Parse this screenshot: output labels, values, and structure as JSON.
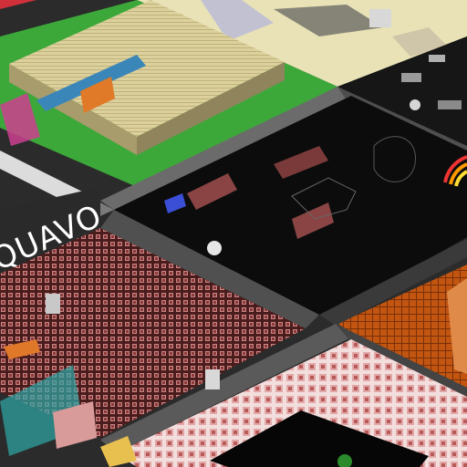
{
  "scene": {
    "view": "isometric",
    "background": "#2b2b2b"
  },
  "plots": [
    {
      "id": "green-building-plot",
      "ground": "#3da83a",
      "content": "warehouse-roof"
    },
    {
      "id": "cream-plot",
      "ground": "#e8e2b6",
      "content": "scattered-structures"
    },
    {
      "id": "dark-gadget-plot",
      "ground": "#161616",
      "content": "grey-machines"
    },
    {
      "id": "center-black-plot",
      "ground": "#0c0c0c",
      "content": "circuit-glyphs"
    },
    {
      "id": "red-tile-plot",
      "ground": "#5a2222",
      "content": "red-tiles"
    },
    {
      "id": "orange-plot",
      "ground": "#b4480e",
      "content": "orange-grid"
    },
    {
      "id": "pink-tile-plot",
      "ground": "#f0d4d4",
      "content": "pink-tiles"
    },
    {
      "id": "white-plot",
      "ground": "#e8e8e8",
      "content": "empty"
    }
  ],
  "labels": {
    "wall_sign": "QUAVO"
  },
  "colors": {
    "wall": "#6b6b6b",
    "wall_dark": "#3a3a3a",
    "warehouse_roof": "#d8cc9a",
    "warehouse_side": "#a89c6c",
    "rainbow": [
      "#e33",
      "#f90",
      "#fd3",
      "#3c3",
      "#36f"
    ]
  }
}
